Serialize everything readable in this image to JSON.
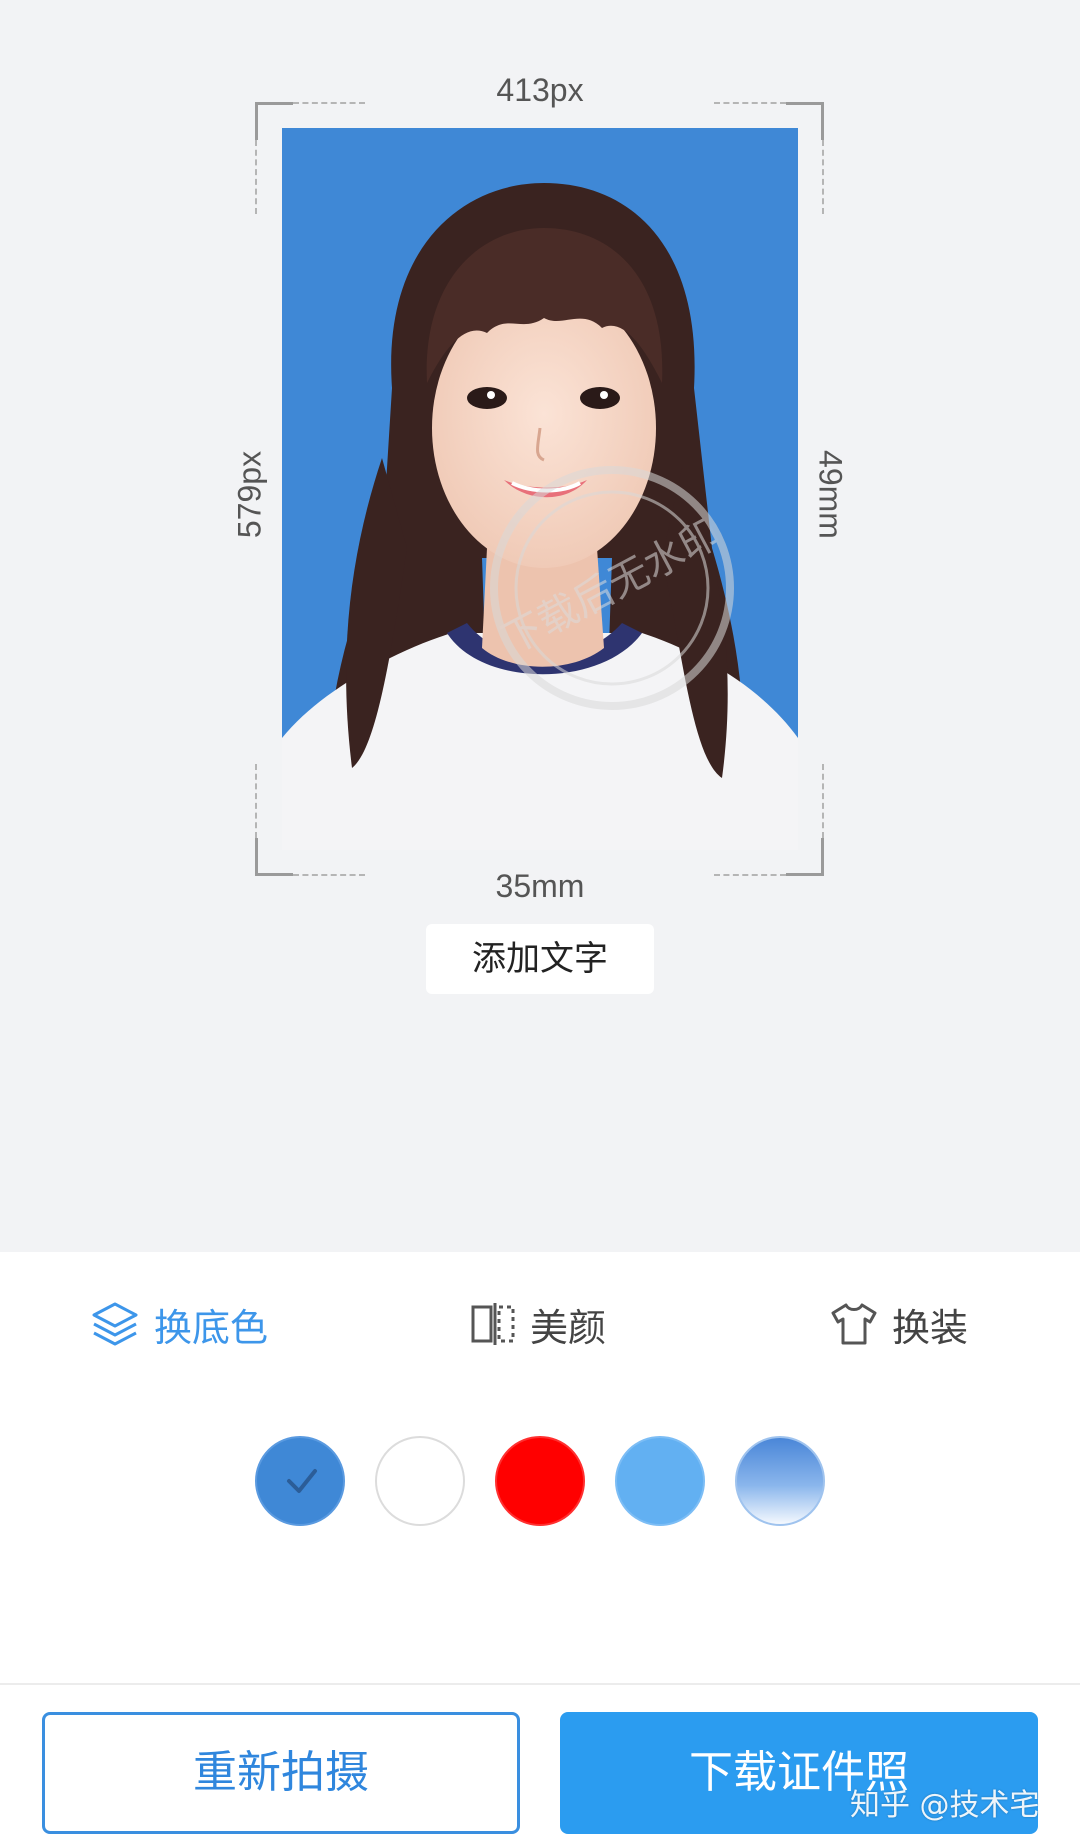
{
  "preview": {
    "width_label": "413px",
    "height_label": "579px",
    "height_mm_label": "49mm",
    "width_mm_label": "35mm",
    "photo_background_color": "#3f88d6",
    "stamp_text": "下载后无水印",
    "add_text_button": "添加文字"
  },
  "tabs": [
    {
      "label": "换底色",
      "icon": "layers-icon",
      "active": true
    },
    {
      "label": "美颜",
      "icon": "compare-icon",
      "active": false
    },
    {
      "label": "换装",
      "icon": "tshirt-icon",
      "active": false
    }
  ],
  "swatches": [
    {
      "name": "dark-blue",
      "color": "#3f88d6",
      "selected": true
    },
    {
      "name": "white",
      "color": "#ffffff",
      "selected": false
    },
    {
      "name": "red",
      "color": "#ff0000",
      "selected": false
    },
    {
      "name": "light-blue",
      "color": "#62b0f2",
      "selected": false
    },
    {
      "name": "gradient-blue",
      "color": "#4a86d8",
      "selected": false
    }
  ],
  "actions": {
    "retake": "重新拍摄",
    "download": "下载证件照"
  },
  "watermark": "知乎 @技术宅",
  "colors": {
    "accent": "#3d96ea",
    "primary_button": "#2b9cf0"
  }
}
